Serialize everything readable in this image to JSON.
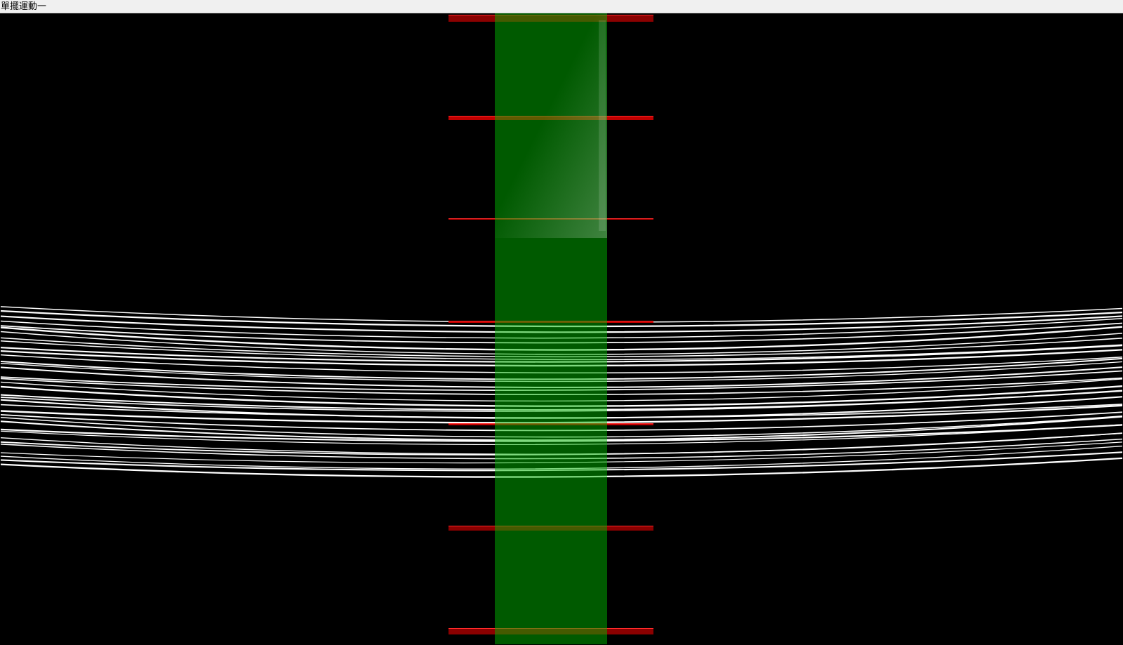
{
  "window": {
    "title": "單擺運動一"
  },
  "scene": {
    "background_color": "#000000",
    "strings": {
      "count": 36,
      "color": "#ffffff"
    },
    "guide_lines": {
      "count": 7,
      "color": "#c00000"
    },
    "highlight_band": {
      "color": "#00b400",
      "opacity": 0.5
    }
  }
}
